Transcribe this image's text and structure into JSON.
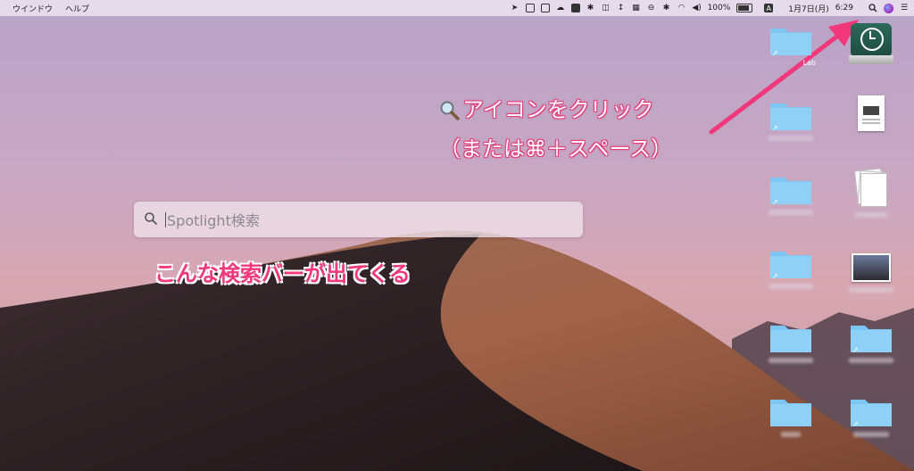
{
  "menubar": {
    "menu_items": [
      "ウインドウ",
      "ヘルプ"
    ],
    "battery_percent": "100%",
    "date": "1月7日(月)",
    "time": "6:29",
    "input_source": "A",
    "icons": [
      "bird-icon",
      "clipboard-icon",
      "calendar-icon",
      "cloud-icon",
      "media-icon",
      "gear-icon",
      "scissors-icon",
      "arrows-icon",
      "grid-icon",
      "restricted-icon",
      "bluetooth-icon",
      "wifi-icon",
      "volume-icon",
      "battery-icon",
      "input-source-icon",
      "spotlight-icon",
      "siri-icon",
      "notification-center-icon"
    ]
  },
  "spotlight": {
    "placeholder": "Spotlight検索"
  },
  "annotations": {
    "line1": "アイコンをクリック",
    "line2": "（または⌘＋スペース）",
    "caption": "こんな検索バーが出てくる"
  },
  "desktop": {
    "partial_label": "Lab"
  },
  "colors": {
    "annotation_pink": "#f0387a",
    "arrow_pink": "#f0387a",
    "folder_blue": "#7cc6f4"
  }
}
